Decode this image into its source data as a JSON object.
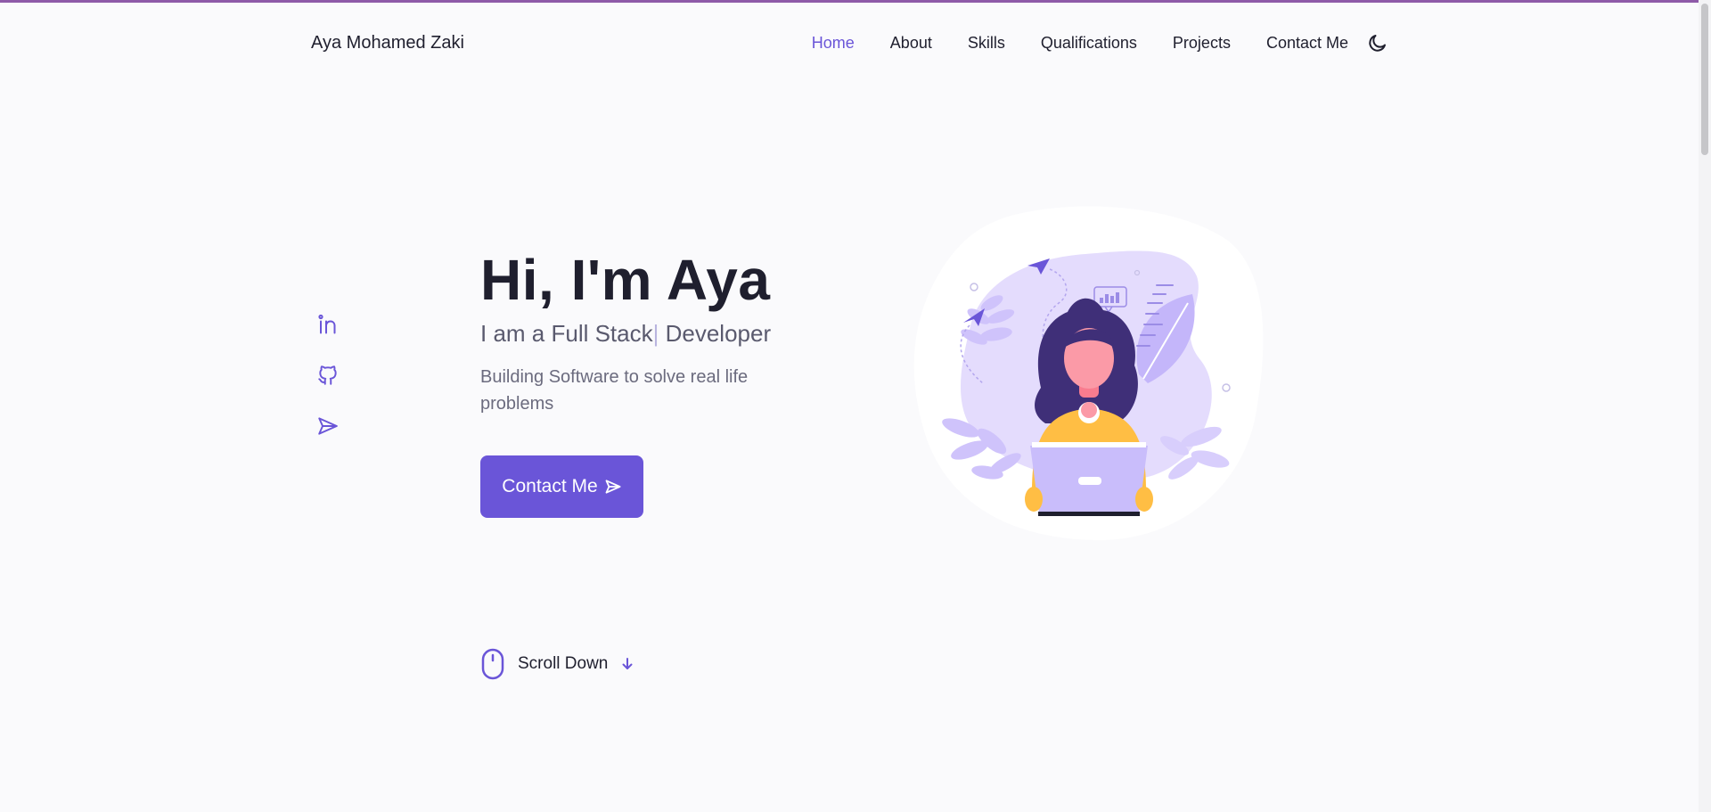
{
  "brand": "Aya Mohamed Zaki",
  "nav": {
    "items": [
      "Home",
      "About",
      "Skills",
      "Qualifications",
      "Projects",
      "Contact Me"
    ],
    "active": "Home",
    "theme_icon": "moon-icon"
  },
  "socials": {
    "icons": [
      "linkedin-icon",
      "github-icon",
      "send-icon"
    ]
  },
  "hero": {
    "title": "Hi, I'm Aya",
    "subtitle_typed": "I am a Full Stack",
    "subtitle_cursor": "|",
    "subtitle_rest": " Developer",
    "description": "Building Software to solve real life problems"
  },
  "cta": {
    "label": "Contact Me",
    "icon": "send-icon"
  },
  "scroll": {
    "label": "Scroll Down",
    "icons": [
      "mouse-icon",
      "arrow-down-icon"
    ]
  },
  "colors": {
    "accent": "#6a55d8",
    "text": "#1f1f2e",
    "muted": "#6b6b7e",
    "background": "#fafafc",
    "top_stripe": "#8e5aa8"
  }
}
